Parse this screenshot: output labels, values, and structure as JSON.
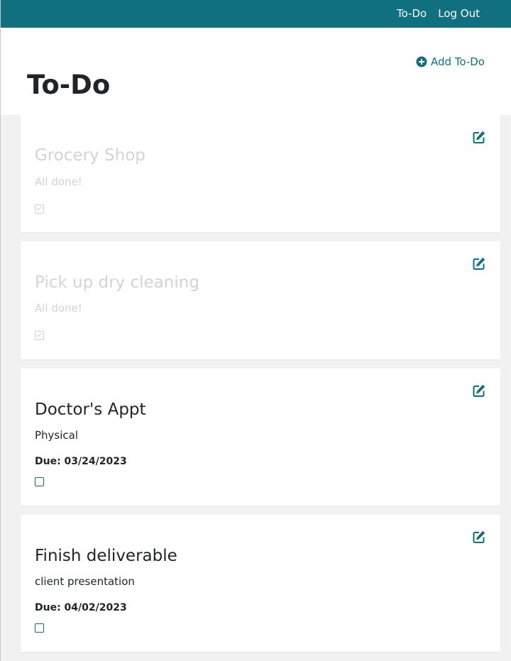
{
  "nav": {
    "links": [
      "To-Do",
      "Log Out"
    ]
  },
  "add_button": {
    "label": "Add To-Do",
    "icon": "plus-circle-icon"
  },
  "page_title": "To-Do",
  "colors": {
    "brand": "#11707f",
    "completed_text": "#d3d3d3",
    "list_background": "#f1f1f1"
  },
  "todos": [
    {
      "title": "Grocery Shop",
      "description": "All done!",
      "due": "",
      "completed": true
    },
    {
      "title": "Pick up dry cleaning",
      "description": "All done!",
      "due": "",
      "completed": true
    },
    {
      "title": "Doctor's Appt",
      "description": "Physical",
      "due": "Due: 03/24/2023",
      "completed": false
    },
    {
      "title": "Finish deliverable",
      "description": "client presentation",
      "due": "Due: 04/02/2023",
      "completed": false
    }
  ]
}
